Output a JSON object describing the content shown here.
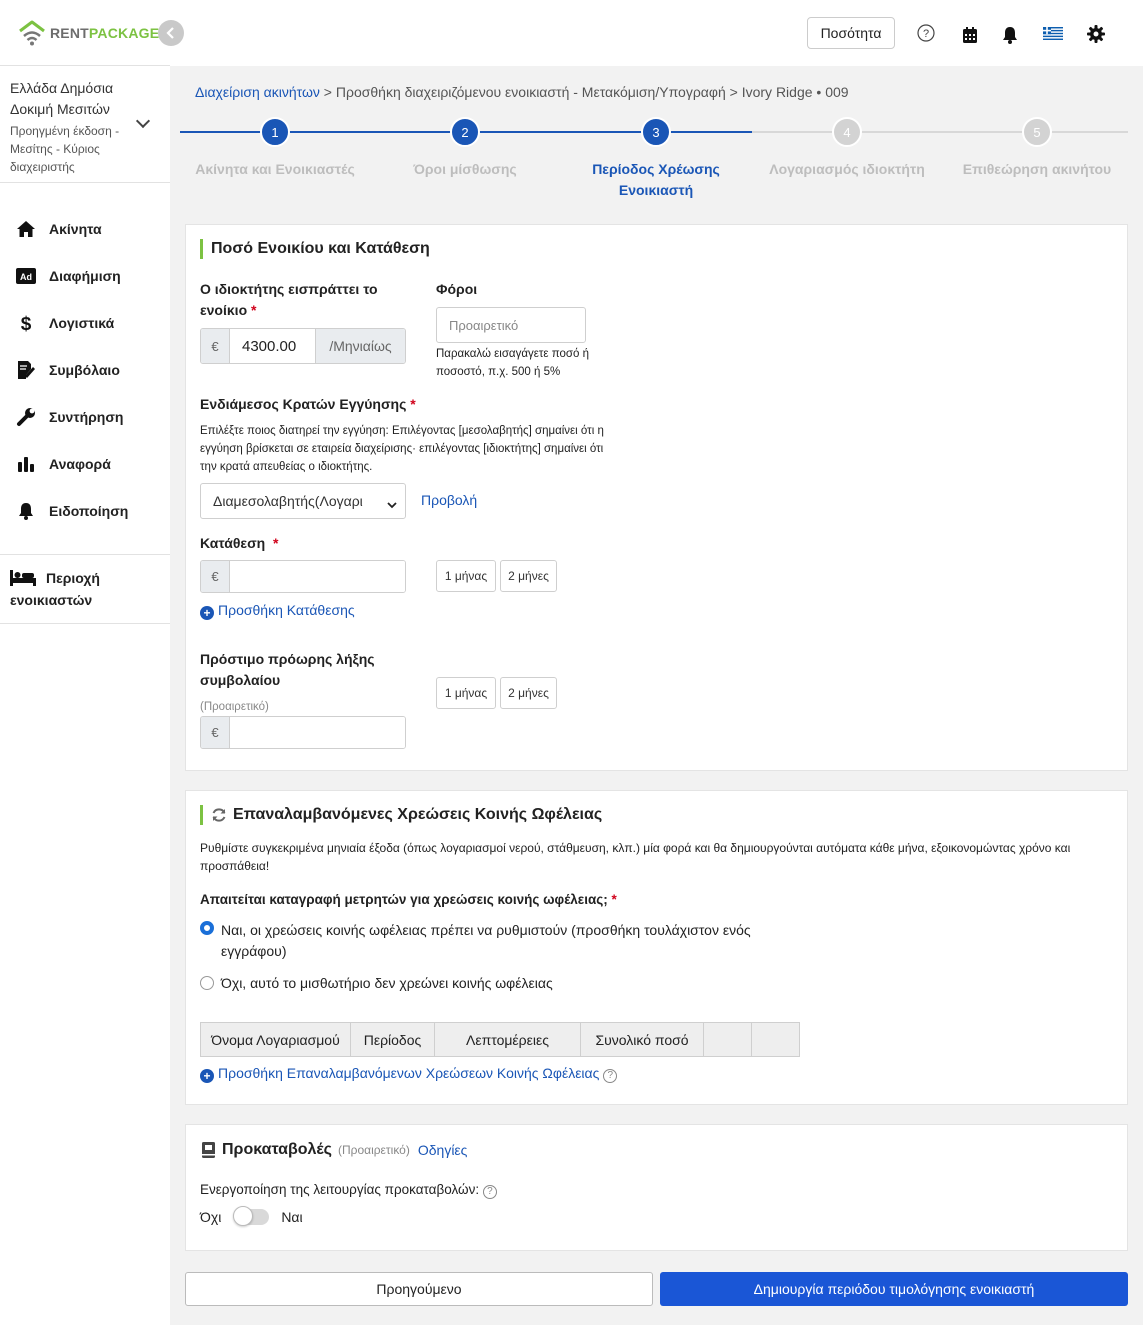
{
  "brand": {
    "name_part1": "RENT",
    "name_part2": "PACKAGE"
  },
  "account": {
    "org": "Ελλάδα Δημόσια Δοκιμή Μεσιτών",
    "role": "Προηγμένη έκδοση - Μεσίτης - Κύριος διαχειριστής"
  },
  "nav": [
    {
      "label": "Ακίνητα",
      "icon": "home-icon"
    },
    {
      "label": "Διαφήμιση",
      "icon": "ad-icon"
    },
    {
      "label": "Λογιστικά",
      "icon": "dollar-icon"
    },
    {
      "label": "Συμβόλαιο",
      "icon": "contract-icon"
    },
    {
      "label": "Συντήρηση",
      "icon": "wrench-icon"
    },
    {
      "label": "Αναφορά",
      "icon": "bar-chart-icon"
    },
    {
      "label": "Ειδοποίηση",
      "icon": "bell-icon"
    }
  ],
  "tenant_area": {
    "label_line1": "Περιοχή",
    "label_line2": "ενοικιαστών"
  },
  "header": {
    "quantity_button": "Ποσότητα"
  },
  "breadcrumb": {
    "link": "Διαχείριση ακινήτων",
    "sep": ">",
    "middle": "Προσθήκη διαχειριζόμενου ενοικιαστή - Μετακόμιση/Υπογραφή",
    "last": "Ivory Ridge • 009"
  },
  "steps": [
    {
      "num": "1",
      "label": "Ακίνητα και Ενοικιαστές",
      "state": "done"
    },
    {
      "num": "2",
      "label": "Όροι μίσθωσης",
      "state": "done"
    },
    {
      "num": "3",
      "label": "Περίοδος Χρέωσης Ενοικιαστή",
      "state": "active"
    },
    {
      "num": "4",
      "label": "Λογαριασμός ιδιοκτήτη",
      "state": "pending"
    },
    {
      "num": "5",
      "label": "Επιθεώρηση ακινήτου",
      "state": "pending"
    }
  ],
  "rent": {
    "title": "Ποσό Ενοικίου και Κατάθεση",
    "rent_label_1": "Ο ιδιοκτήτης εισπράττει το",
    "rent_label_2": "ενοίκιο",
    "required_mark": "*",
    "currency": "€",
    "rent_value": "4300.00",
    "rent_period": "/Μηνιαίως",
    "tax_label": "Φόροι",
    "tax_placeholder": "Προαιρετικό",
    "tax_help_1": "Παρακαλώ εισαγάγετε ποσό ή",
    "tax_help_2": "ποσοστό, π.χ. 500 ή 5%",
    "holder_label": "Ενδιάμεσος Κρατών Εγγύησης",
    "holder_help_1": "Επιλέξτε ποιος διατηρεί την εγγύηση: Επιλέγοντας [μεσολαβητής] σημαίνει ότι η",
    "holder_help_2": "εγγύηση βρίσκεται σε εταιρεία διαχείρισης· επιλέγοντας [ιδιοκτήτης] σημαίνει ότι",
    "holder_help_3": "την κρατά απευθείας ο ιδιοκτήτης.",
    "holder_select": "Διαμεσολαβητής(Λογαρι",
    "holder_view_link": "Προβολή",
    "deposit_label": "Κατάθεση",
    "deposit_value": "",
    "chip_1m": "1 μήνας",
    "chip_2m": "2 μήνες",
    "add_deposit": "Προσθήκη Κατάθεσης",
    "penalty_label_1": "Πρόστιμο πρόωρης λήξης",
    "penalty_label_2": "συμβολαίου",
    "penalty_optional": "(Προαιρετικό)",
    "penalty_value": ""
  },
  "utilities": {
    "title": "Επαναλαμβανόμενες Χρεώσεις Κοινής Ωφέλειας",
    "desc_1": "Ρυθμίστε συγκεκριμένα μηνιαία έξοδα (όπως λογαριασμοί νερού, στάθμευση, κλπ.) μία φορά και θα δημιουργούνται αυτόματα κάθε μήνα, εξοικονομώντας χρόνο και",
    "desc_2": "προσπάθεια!",
    "question": "Απαιτείται καταγραφή μετρητών για χρεώσεις κοινής ωφέλειας;",
    "opt_yes_1": "Ναι, οι χρεώσεις κοινής ωφέλειας πρέπει να ρυθμιστούν (προσθήκη τουλάχιστον ενός",
    "opt_yes_2": "εγγράφου)",
    "opt_no": "Όχι, αυτό το μισθωτήριο δεν χρεώνει κοινής ωφέλειας",
    "selected": "yes",
    "columns": [
      "Όνομα Λογαριασμού",
      "Περίοδος",
      "Λεπτομέρειες",
      "Συνολικό ποσό",
      "",
      ""
    ],
    "add_link": "Προσθήκη Επαναλαμβανόμενων Χρεώσεων Κοινής Ωφέλειας"
  },
  "prepay": {
    "title": "Προκαταβολές",
    "optional": "(Προαιρετικό)",
    "guide_link": "Οδηγίες",
    "enable_label": "Ενεργοποίηση της λειτουργίας προκαταβολών:",
    "off_label": "Όχι",
    "on_label": "Ναι",
    "enabled": false
  },
  "actions": {
    "prev": "Προηγούμενο",
    "next": "Δημιουργία περιόδου τιμολόγησης ενοικιαστή"
  },
  "colors": {
    "primary": "#1a56b6",
    "accent_green": "#7cc242",
    "step_pending": "#d3d3d3",
    "button_blue": "#1a56d6"
  }
}
